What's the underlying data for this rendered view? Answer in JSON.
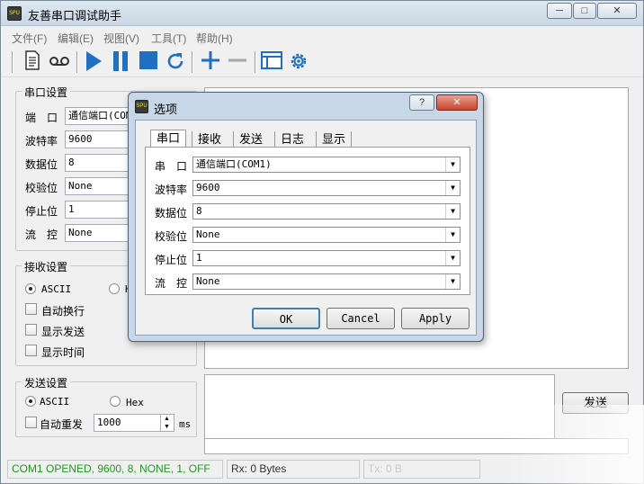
{
  "window": {
    "title": "友善串口调试助手",
    "app_icon_text": "SPU",
    "caption_buttons": {
      "minimize": "─",
      "maximize": "□",
      "close": "✕"
    }
  },
  "menu": [
    "文件(F)",
    "编辑(E)",
    "视图(V)",
    "工具(T)",
    "帮助(H)"
  ],
  "toolbar": {
    "icons": [
      "document-icon",
      "record-icon",
      "play-icon",
      "pause-icon",
      "stop-icon",
      "refresh-icon",
      "add-icon",
      "remove-icon",
      "window-icon",
      "gear-icon"
    ]
  },
  "serial_settings": {
    "title": "串口设置",
    "rows": [
      {
        "label": "端　口",
        "value": "通信端口(COM"
      },
      {
        "label": "波特率",
        "value": "9600"
      },
      {
        "label": "数据位",
        "value": "8"
      },
      {
        "label": "校验位",
        "value": "None"
      },
      {
        "label": "停止位",
        "value": "1"
      },
      {
        "label": "流　控",
        "value": "None"
      }
    ]
  },
  "receive_settings": {
    "title": "接收设置",
    "radio_ascii": "ASCII",
    "radio_hex": "H",
    "checkboxes": [
      "自动换行",
      "显示发送",
      "显示时间"
    ]
  },
  "send_settings": {
    "title": "发送设置",
    "radio_ascii": "ASCII",
    "radio_hex": "Hex",
    "auto_resend": "自动重发",
    "interval": "1000",
    "unit": "ms",
    "send_button": "发送"
  },
  "status_bar": {
    "connection": "COM1 OPENED, 9600, 8, NONE, 1, OFF",
    "rx": "Rx: 0 Bytes",
    "tx": "Tx: 0 B"
  },
  "dialog": {
    "title": "选项",
    "help_button": "?",
    "close_button": "✕",
    "tabs": [
      "串口",
      "接收",
      "发送",
      "日志",
      "显示"
    ],
    "rows": [
      {
        "label": "串　口",
        "value": "通信端口(COM1)"
      },
      {
        "label": "波特率",
        "value": "9600"
      },
      {
        "label": "数据位",
        "value": "8"
      },
      {
        "label": "校验位",
        "value": "None"
      },
      {
        "label": "停止位",
        "value": "1"
      },
      {
        "label": "流　控",
        "value": "None"
      }
    ],
    "ok": "OK",
    "cancel": "Cancel",
    "apply": "Apply"
  },
  "colors": {
    "status_text": "#1e9a1e",
    "accent": "#1f6fc5"
  }
}
